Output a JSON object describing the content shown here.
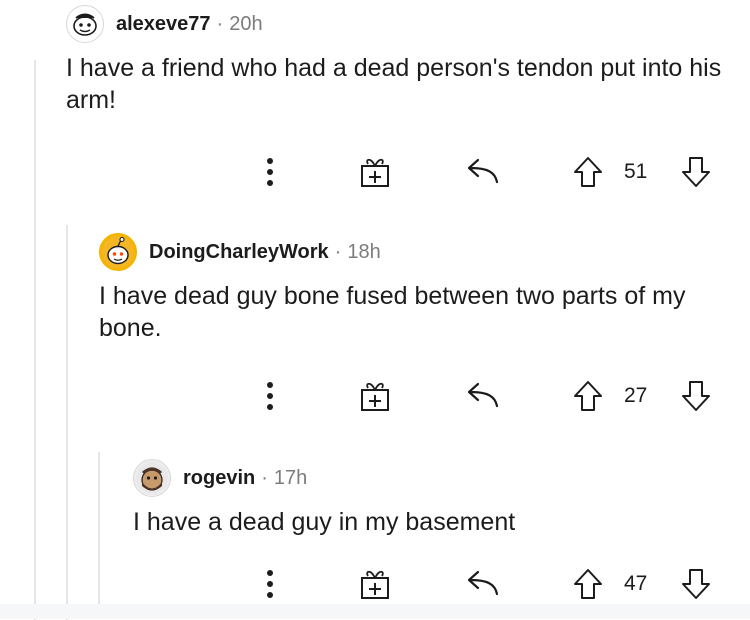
{
  "comments": [
    {
      "username": "alexeve77",
      "separator": "·",
      "age": "20h",
      "body": "I have a friend who had a dead person's tendon put into his arm!",
      "score": "51"
    },
    {
      "username": "DoingCharleyWork",
      "separator": "·",
      "age": "18h",
      "body": "I have dead guy bone fused between two parts of my bone.",
      "score": "27"
    },
    {
      "username": "rogevin",
      "separator": "·",
      "age": "17h",
      "body": "I have a dead guy in my basement",
      "score": "47"
    }
  ],
  "icons": {
    "more": "more-options-icon",
    "award": "award-gift-icon",
    "reply": "reply-arrow-icon",
    "upvote": "upvote-arrow-icon",
    "downvote": "downvote-arrow-icon"
  },
  "colors": {
    "text": "#1c1c1c",
    "meta": "#7c7c7c",
    "thread_line": "#e6e6e6"
  }
}
